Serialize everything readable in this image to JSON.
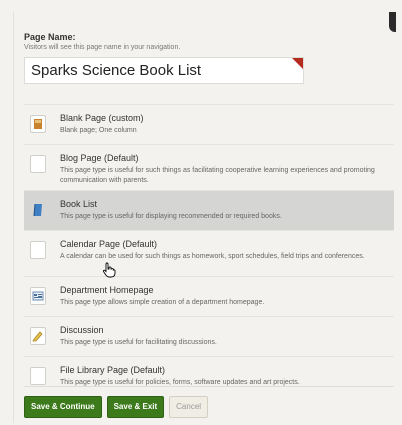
{
  "page_name": {
    "label": "Page Name:",
    "help": "Visitors will see this page name in your navigation.",
    "value": "Sparks Science Book List"
  },
  "page_types": [
    {
      "title": "Blank Page (custom)",
      "desc": "Blank page; One column",
      "icon": "book-icon",
      "selected": false
    },
    {
      "title": "Blog Page (Default)",
      "desc": "This page type is useful for such things as facilitating cooperative learning experiences and promoting communication with parents.",
      "icon": "blank-icon",
      "selected": false
    },
    {
      "title": "Book List",
      "desc": "This page type is useful for displaying recommended or required books.",
      "icon": "blue-book-icon",
      "selected": true
    },
    {
      "title": "Calendar Page (Default)",
      "desc": "A calendar can be used for such things as homework, sport schedules, field trips and conferences.",
      "icon": "blank-icon",
      "selected": false
    },
    {
      "title": "Department Homepage",
      "desc": "This page type allows simple creation of a department homepage.",
      "icon": "department-icon",
      "selected": false
    },
    {
      "title": "Discussion",
      "desc": "This page type is useful for facilitating discussions.",
      "icon": "discussion-icon",
      "selected": false
    },
    {
      "title": "File Library Page (Default)",
      "desc": "This page type is useful for policies, forms, software updates and art projects.",
      "icon": "blank-icon",
      "selected": false
    }
  ],
  "buttons": {
    "save_continue": "Save & Continue",
    "save_exit": "Save & Exit",
    "cancel": "Cancel"
  },
  "colors": {
    "accent_green": "#3c7a1c",
    "flag_red": "#b52a1f",
    "selected_row": "#d5d5d3"
  }
}
